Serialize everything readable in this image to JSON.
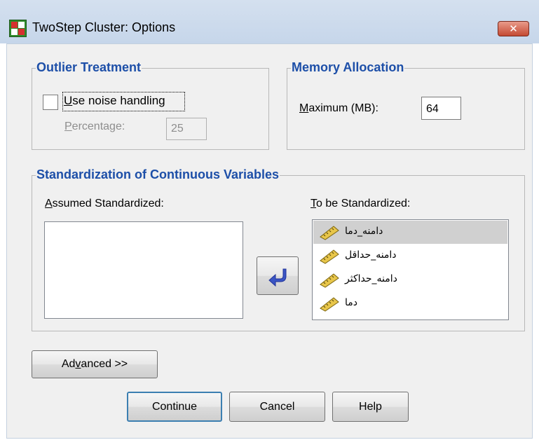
{
  "window": {
    "title": "TwoStep Cluster: Options",
    "close_label": "✕"
  },
  "outlier": {
    "legend": "Outlier Treatment",
    "noise_label_pre": "",
    "noise_label_key": "U",
    "noise_label_post": "se noise handling",
    "noise_checked": false,
    "percentage_key": "P",
    "percentage_post": "ercentage:",
    "percentage_value": "25"
  },
  "memory": {
    "legend": "Memory Allocation",
    "max_key": "M",
    "max_post": "aximum (MB):",
    "max_value": "64"
  },
  "standardization": {
    "legend": "Standardization of Continuous Variables",
    "assumed_key": "A",
    "assumed_post": "ssumed Standardized:",
    "tobe_key": "T",
    "tobe_post": "o be Standardized:",
    "assumed_items": [],
    "tobe_items": [
      {
        "label": "دامنه_دما",
        "selected": true
      },
      {
        "label": "دامنه_حداقل",
        "selected": false
      },
      {
        "label": "دامنه_حداکثر",
        "selected": false
      },
      {
        "label": "دما",
        "selected": false
      }
    ]
  },
  "buttons": {
    "advanced_pre": "Ad",
    "advanced_key": "v",
    "advanced_post": "anced >>",
    "continue": "Continue",
    "cancel": "Cancel",
    "help": "Help"
  },
  "colors": {
    "legend": "#1d4fa8",
    "titlebar": "#c6d6ea",
    "selection": "#d0d0d0"
  },
  "icons": [
    "spss-app-icon",
    "close-icon",
    "ruler-scale-icon",
    "left-arrow-icon"
  ]
}
